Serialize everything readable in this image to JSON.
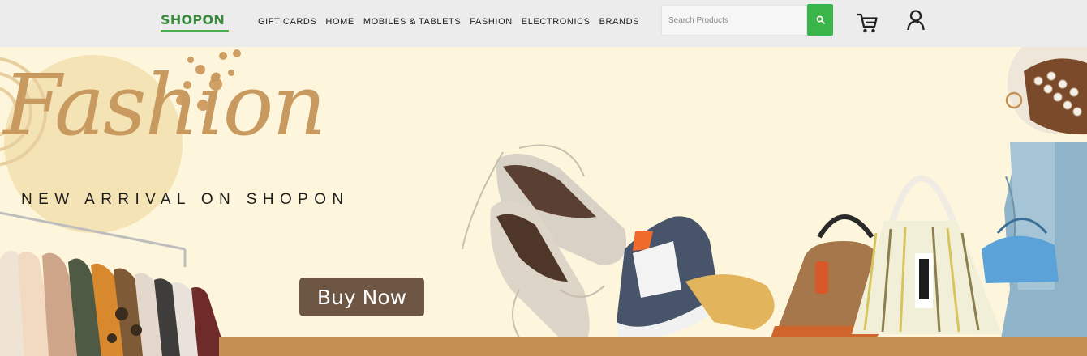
{
  "header": {
    "logo_text": "SHOPON",
    "nav": [
      "GIFT CARDS",
      "HOME",
      "MOBILES & TABLETS",
      "FASHION",
      "ELECTRONICS",
      "BRANDS"
    ],
    "search_placeholder": "Search Products",
    "search_icon": "search-icon",
    "cart_icon": "cart-icon",
    "user_icon": "user-icon",
    "accent_color": "#3ab54a"
  },
  "hero": {
    "title": "Fashion",
    "subtitle": "NEW ARRIVAL ON SHOPON",
    "cta": "Buy Now",
    "background_color": "#fdf6dc",
    "cta_color": "#6e5644",
    "title_color": "#c99a5f"
  }
}
